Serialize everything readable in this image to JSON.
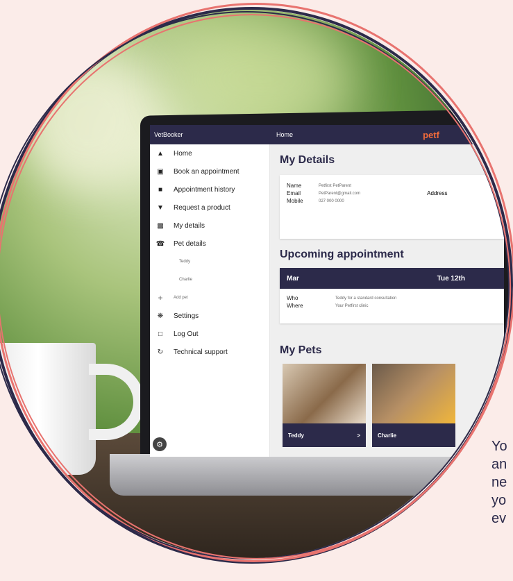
{
  "app": {
    "brand": "VetBooker",
    "breadcrumb": "Home",
    "logo_text": "petf"
  },
  "sidebar": {
    "items": [
      {
        "label": "Home",
        "icon": "home-icon"
      },
      {
        "label": "Book an appointment",
        "icon": "calendar-icon"
      },
      {
        "label": "Appointment history",
        "icon": "history-icon"
      },
      {
        "label": "Request a product",
        "icon": "basket-icon"
      },
      {
        "label": "My details",
        "icon": "id-card-icon"
      },
      {
        "label": "Pet details",
        "icon": "pet-icon"
      }
    ],
    "pets": [
      "Teddy",
      "Charlie"
    ],
    "add_pet": "Add pet",
    "bottom_items": [
      {
        "label": "Settings",
        "icon": "gear-icon"
      },
      {
        "label": "Log Out",
        "icon": "logout-icon"
      },
      {
        "label": "Technical support",
        "icon": "support-icon"
      }
    ]
  },
  "details": {
    "title": "My Details",
    "name_label": "Name",
    "name_value": "Petfirst PetParent",
    "email_label": "Email",
    "email_value": "PetParent@gmail.com",
    "mobile_label": "Mobile",
    "mobile_value": "027 000 0000",
    "address_label": "Address"
  },
  "appointment": {
    "title": "Upcoming appointment",
    "month": "Mar",
    "date": "Tue 12th",
    "who_label": "Who",
    "who_value": "Teddy for a standard consultation",
    "where_label": "Where",
    "where_value": "Your Petfirst clinic"
  },
  "pets_section": {
    "title": "My Pets",
    "cards": [
      {
        "name": "Teddy",
        "arrow": ">"
      },
      {
        "name": "Charlie"
      }
    ]
  },
  "side_text": [
    "Yo",
    "an",
    "ne",
    "yo",
    "ev"
  ],
  "colors": {
    "navy": "#2c2a4a",
    "coral": "#e8736f",
    "background": "#fbece9"
  }
}
